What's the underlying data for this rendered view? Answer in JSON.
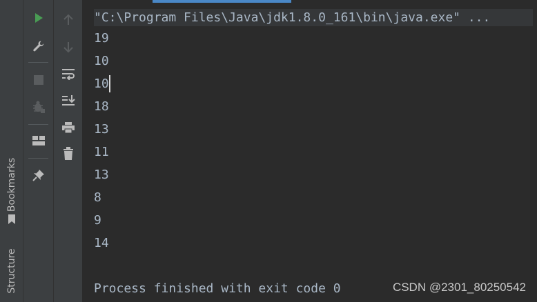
{
  "side_tabs": {
    "bookmarks": "Bookmarks",
    "structure": "Structure"
  },
  "toolbar_left": [
    {
      "icon": "run-icon",
      "color": "#499c54"
    },
    {
      "icon": "wrench-icon"
    },
    {
      "icon": "stop-icon"
    },
    {
      "icon": "debug-bug-icon"
    },
    {
      "icon": "layout-icon"
    },
    {
      "icon": "pin-icon"
    }
  ],
  "toolbar_right": [
    {
      "icon": "up-arrow-icon"
    },
    {
      "icon": "down-arrow-icon"
    },
    {
      "icon": "soft-wrap-icon"
    },
    {
      "icon": "scroll-to-end-icon"
    },
    {
      "icon": "print-icon"
    },
    {
      "icon": "trash-icon"
    }
  ],
  "console": {
    "command": "\"C:\\Program Files\\Java\\jdk1.8.0_161\\bin\\java.exe\" ...",
    "output": [
      "19",
      "10",
      "10",
      "18",
      "13",
      "11",
      "13",
      "8",
      "9",
      "14"
    ],
    "exit_message": "Process finished with exit code 0",
    "colors": {
      "text": "#a9b7c6",
      "background": "#2b2b2b"
    }
  },
  "watermark": "CSDN @2301_80250542"
}
